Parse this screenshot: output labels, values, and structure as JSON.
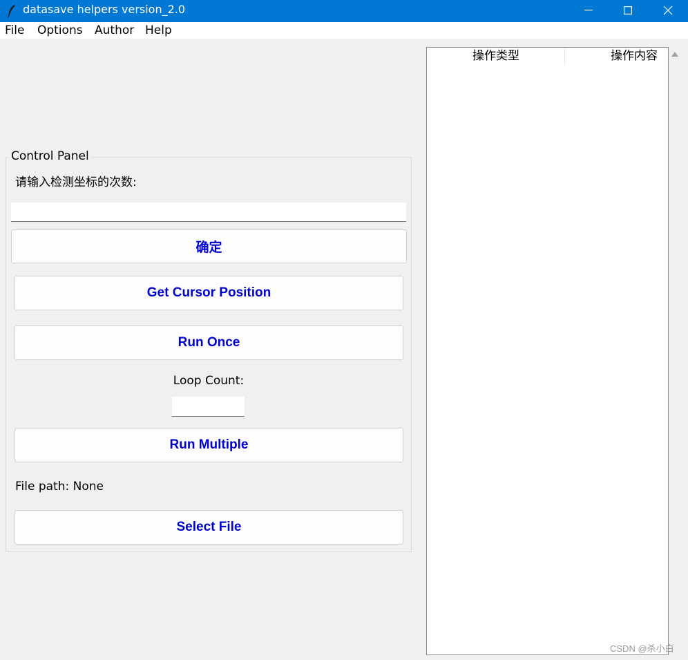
{
  "window": {
    "title": "datasave helpers version_2.0",
    "accent_color": "#0078d4",
    "controls": [
      "minimize-icon",
      "maximize-icon",
      "close-icon"
    ]
  },
  "menu": {
    "file": "File",
    "options": "Options",
    "author": "Author",
    "help": "Help"
  },
  "control_panel": {
    "title": "Control Panel",
    "prompt_label": "请输入检测坐标的次数:",
    "count_value": "",
    "confirm_button": "确定",
    "get_cursor_button": "Get Cursor Position",
    "run_once_button": "Run Once",
    "loop_count_label": "Loop Count:",
    "loop_count_value": "",
    "run_multiple_button": "Run Multiple",
    "file_path_label": "File path: None",
    "select_file_button": "Select File",
    "button_text_color": "#0000d0"
  },
  "operations_table": {
    "columns": [
      "操作类型",
      "操作内容"
    ],
    "rows": []
  },
  "watermark": "CSDN @杀小白"
}
